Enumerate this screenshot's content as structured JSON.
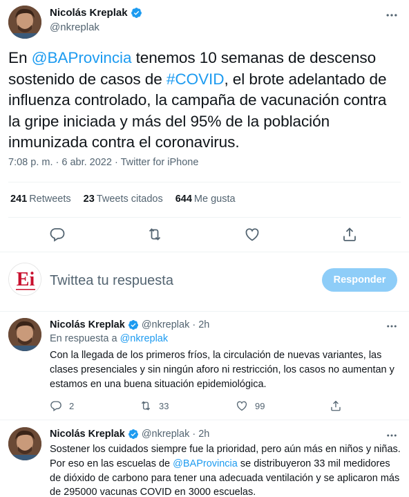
{
  "colors": {
    "link": "#1d9bf0",
    "muted": "#536471",
    "text": "#0f1419",
    "reply_button_bg": "#8ecdf8"
  },
  "main_tweet": {
    "author_name": "Nicolás Kreplak",
    "author_handle": "@nkreplak",
    "text_parts": {
      "p1": "En ",
      "mention": "@BAProvincia",
      "p2": " tenemos 10 semanas de descenso sostenido de casos de ",
      "hashtag": "#COVID",
      "p3": ", el brote adelantado de influenza controlado, la campaña de vacunación contra la gripe iniciada y más del 95% de la población inmunizada contra el coronavirus."
    },
    "time": "7:08 p. m.",
    "date": "6 abr. 2022",
    "source": "Twitter for iPhone",
    "sep": " · ",
    "stats": {
      "retweets_count": "241",
      "retweets_label": "Retweets",
      "quotes_count": "23",
      "quotes_label": "Tweets citados",
      "likes_count": "644",
      "likes_label": "Me gusta"
    },
    "action_icons": [
      "reply-icon",
      "retweet-icon",
      "like-icon",
      "share-icon"
    ]
  },
  "compose": {
    "avatar_logo": "Ei",
    "placeholder": "Twittea tu respuesta",
    "button_label": "Responder"
  },
  "replies": [
    {
      "author_name": "Nicolás Kreplak",
      "author_handle": "@nkreplak",
      "time_ago": "2h",
      "in_reply_prefix": "En respuesta a ",
      "in_reply_handle": "@nkreplak",
      "text": "Con la llegada de los primeros fríos, la circulación de nuevas variantes, las clases presenciales y sin ningún aforo ni restricción, los casos no aumentan y estamos en una buena situación epidemiológica.",
      "reply_count": "2",
      "retweet_count": "33",
      "like_count": "99"
    },
    {
      "author_name": "Nicolás Kreplak",
      "author_handle": "@nkreplak",
      "time_ago": "2h",
      "text_p1": "Sostener los cuidados siempre fue la prioridad, pero aún más en niños y niñas. Por eso en las escuelas de ",
      "text_mention": "@BAProvincia",
      "text_p2": " se distribuyeron 33 mil medidores de dióxido de carbono para tener una adecuada ventilación y se aplicaron más de 295000 vacunas COVID en 3000 escuelas."
    }
  ]
}
